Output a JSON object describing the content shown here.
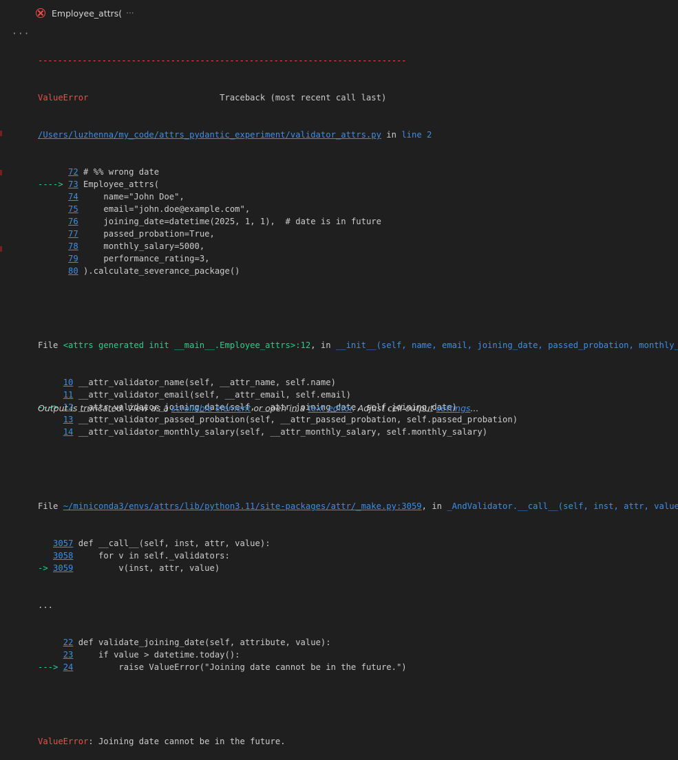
{
  "header": {
    "title": "Employee_attrs(",
    "more": "···"
  },
  "gutter": {
    "more": "···"
  },
  "trace": {
    "separator": "---------------------------------------------------------------------------",
    "error_type": "ValueError",
    "traceback_header": "                          Traceback (most recent call last)",
    "file1": {
      "path": "/Users/luzhenna/my_code/attrs_pydantic_experiment/validator_attrs.py",
      "in": " in ",
      "where": "line 2"
    },
    "block1": [
      {
        "arrow": "      ",
        "num": "72",
        "code": " # %% wrong date"
      },
      {
        "arrow": "----> ",
        "num": "73",
        "code": " Employee_attrs("
      },
      {
        "arrow": "      ",
        "num": "74",
        "code": "     name=\"John Doe\","
      },
      {
        "arrow": "      ",
        "num": "75",
        "code": "     email=\"john.doe@example.com\","
      },
      {
        "arrow": "      ",
        "num": "76",
        "code": "     joining_date=datetime(2025, 1, 1),  # date is in future"
      },
      {
        "arrow": "      ",
        "num": "77",
        "code": "     passed_probation=True,"
      },
      {
        "arrow": "      ",
        "num": "78",
        "code": "     monthly_salary=5000,"
      },
      {
        "arrow": "      ",
        "num": "79",
        "code": "     performance_rating=3,"
      },
      {
        "arrow": "      ",
        "num": "80",
        "code": " ).calculate_severance_package()"
      }
    ],
    "file2": {
      "prefix": "File ",
      "location": "<attrs generated init __main__.Employee_attrs>:12",
      "in": ", in ",
      "where": "__init__(self, name, email, joining_date, passed_probation, monthly_salary, performance_rating)"
    },
    "block2": [
      {
        "arrow": "     ",
        "num": "10",
        "code": " __attr_validator_name(self, __attr_name, self.name)"
      },
      {
        "arrow": "     ",
        "num": "11",
        "code": " __attr_validator_email(self, __attr_email, self.email)"
      },
      {
        "arrow": "---> ",
        "num": "12",
        "code": " __attr_validator_joining_date(self, __attr_joining_date, self.joining_date)"
      },
      {
        "arrow": "     ",
        "num": "13",
        "code": " __attr_validator_passed_probation(self, __attr_passed_probation, self.passed_probation)"
      },
      {
        "arrow": "     ",
        "num": "14",
        "code": " __attr_validator_monthly_salary(self, __attr_monthly_salary, self.monthly_salary)"
      }
    ],
    "file3": {
      "prefix": "File ",
      "path": "~/miniconda3/envs/attrs/lib/python3.11/site-packages/attr/_make.py:3059",
      "in": ", in ",
      "where": "_AndValidator.__call__(self, inst, attr, value)"
    },
    "block3": [
      {
        "arrow": "   ",
        "num": "3057",
        "code": " def __call__(self, inst, attr, value):"
      },
      {
        "arrow": "   ",
        "num": "3058",
        "code": "     for v in self._validators:"
      },
      {
        "arrow": "-> ",
        "num": "3059",
        "code": "         v(inst, attr, value)"
      }
    ],
    "ellipsis": "...",
    "block4": [
      {
        "arrow": "     ",
        "num": "22",
        "code": " def validate_joining_date(self, attribute, value):"
      },
      {
        "arrow": "     ",
        "num": "23",
        "code": "     if value > datetime.today():"
      },
      {
        "arrow": "---> ",
        "num": "24",
        "code": "         raise ValueError(\"Joining date cannot be in the future.\")"
      }
    ],
    "final_error": {
      "type": "ValueError",
      "message": ": Joining date cannot be in the future."
    }
  },
  "truncation": {
    "t1": "Output is truncated. View as a ",
    "link1": "scrollable element",
    "t2": " or open in a ",
    "link2": "text editor",
    "t3": ". Adjust cell output ",
    "link3": "settings",
    "t4": "..."
  },
  "colors": {
    "error": "#f14c4c",
    "arrow": "#23d18b",
    "link": "#3b8eea",
    "background": "#1f1f1f"
  }
}
